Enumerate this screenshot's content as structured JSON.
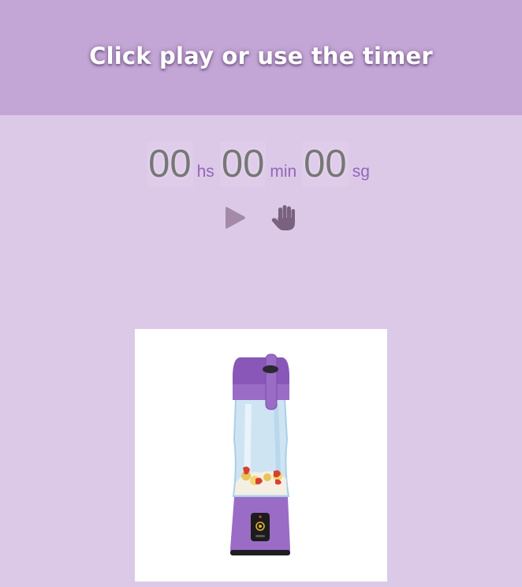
{
  "header": {
    "title": "Click play or use the timer"
  },
  "timer": {
    "hours": "00",
    "hours_unit": "hs",
    "minutes": "00",
    "minutes_unit": "min",
    "seconds": "00",
    "seconds_unit": "sg"
  },
  "controls": {
    "play_icon": "play-icon",
    "stop_icon": "hand-stop-icon"
  },
  "image": {
    "subject": "blender-illustration"
  },
  "colors": {
    "background": "#dcc9e8",
    "header": "#c3a6d6",
    "accent": "#9366b8",
    "digits": "#777777"
  }
}
